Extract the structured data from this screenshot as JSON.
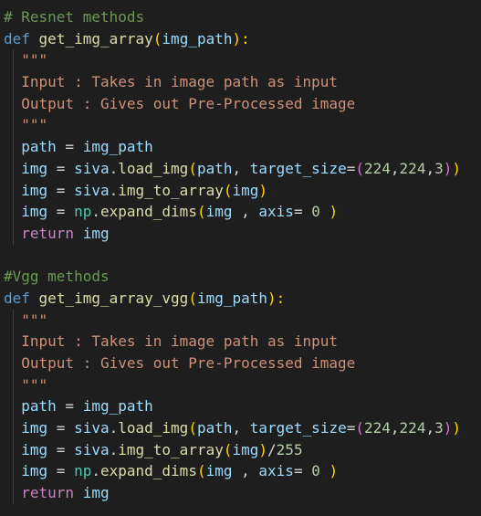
{
  "editor": {
    "lines": [
      {
        "indent": false,
        "tokens": [
          {
            "t": "# Resnet methods",
            "c": "comment"
          }
        ]
      },
      {
        "indent": false,
        "tokens": [
          {
            "t": "def",
            "c": "kw"
          },
          {
            "t": " ",
            "c": "plain"
          },
          {
            "t": "get_img_array",
            "c": "fn"
          },
          {
            "t": "(",
            "c": "b1"
          },
          {
            "t": "img_path",
            "c": "param"
          },
          {
            "t": "):",
            "c": "b1"
          }
        ]
      },
      {
        "indent": true,
        "tokens": [
          {
            "t": "  \"\"\"",
            "c": "str"
          }
        ]
      },
      {
        "indent": true,
        "tokens": [
          {
            "t": "  Input : Takes in image path as input",
            "c": "str"
          }
        ]
      },
      {
        "indent": true,
        "tokens": [
          {
            "t": "  Output : Gives out Pre-Processed image",
            "c": "str"
          }
        ]
      },
      {
        "indent": true,
        "tokens": [
          {
            "t": "  \"\"\"",
            "c": "str"
          }
        ]
      },
      {
        "indent": true,
        "tokens": [
          {
            "t": "  ",
            "c": "plain"
          },
          {
            "t": "path",
            "c": "param"
          },
          {
            "t": " = ",
            "c": "plain"
          },
          {
            "t": "img_path",
            "c": "param"
          }
        ]
      },
      {
        "indent": true,
        "tokens": [
          {
            "t": "  ",
            "c": "plain"
          },
          {
            "t": "img",
            "c": "param"
          },
          {
            "t": " = ",
            "c": "plain"
          },
          {
            "t": "siva",
            "c": "param"
          },
          {
            "t": ".",
            "c": "plain"
          },
          {
            "t": "load_img",
            "c": "fn"
          },
          {
            "t": "(",
            "c": "b1"
          },
          {
            "t": "path",
            "c": "param"
          },
          {
            "t": ", ",
            "c": "plain"
          },
          {
            "t": "target_size",
            "c": "param"
          },
          {
            "t": "=",
            "c": "plain"
          },
          {
            "t": "(",
            "c": "b2"
          },
          {
            "t": "224",
            "c": "num"
          },
          {
            "t": ",",
            "c": "plain"
          },
          {
            "t": "224",
            "c": "num"
          },
          {
            "t": ",",
            "c": "plain"
          },
          {
            "t": "3",
            "c": "num"
          },
          {
            "t": ")",
            "c": "b2"
          },
          {
            "t": ")",
            "c": "b1"
          }
        ]
      },
      {
        "indent": true,
        "tokens": [
          {
            "t": "  ",
            "c": "plain"
          },
          {
            "t": "img",
            "c": "param"
          },
          {
            "t": " = ",
            "c": "plain"
          },
          {
            "t": "siva",
            "c": "param"
          },
          {
            "t": ".",
            "c": "plain"
          },
          {
            "t": "img_to_array",
            "c": "fn"
          },
          {
            "t": "(",
            "c": "b1"
          },
          {
            "t": "img",
            "c": "param"
          },
          {
            "t": ")",
            "c": "b1"
          }
        ]
      },
      {
        "indent": true,
        "tokens": [
          {
            "t": "  ",
            "c": "plain"
          },
          {
            "t": "img",
            "c": "param"
          },
          {
            "t": " = ",
            "c": "plain"
          },
          {
            "t": "np",
            "c": "mod"
          },
          {
            "t": ".",
            "c": "plain"
          },
          {
            "t": "expand_dims",
            "c": "fn"
          },
          {
            "t": "(",
            "c": "b1"
          },
          {
            "t": "img",
            "c": "param"
          },
          {
            "t": " , ",
            "c": "plain"
          },
          {
            "t": "axis",
            "c": "param"
          },
          {
            "t": "= ",
            "c": "plain"
          },
          {
            "t": "0",
            "c": "num"
          },
          {
            "t": " ",
            "c": "plain"
          },
          {
            "t": ")",
            "c": "b1"
          }
        ]
      },
      {
        "indent": true,
        "tokens": [
          {
            "t": "  ",
            "c": "plain"
          },
          {
            "t": "return",
            "c": "ctl"
          },
          {
            "t": " ",
            "c": "plain"
          },
          {
            "t": "img",
            "c": "param"
          }
        ]
      },
      {
        "indent": false,
        "tokens": [
          {
            "t": "",
            "c": "plain"
          }
        ]
      },
      {
        "indent": false,
        "tokens": [
          {
            "t": "#Vgg methods",
            "c": "comment"
          }
        ]
      },
      {
        "indent": false,
        "tokens": [
          {
            "t": "def",
            "c": "kw"
          },
          {
            "t": " ",
            "c": "plain"
          },
          {
            "t": "get_img_array_vgg",
            "c": "fn"
          },
          {
            "t": "(",
            "c": "b1"
          },
          {
            "t": "img_path",
            "c": "param"
          },
          {
            "t": "):",
            "c": "b1"
          }
        ]
      },
      {
        "indent": true,
        "tokens": [
          {
            "t": "  \"\"\"",
            "c": "str"
          }
        ]
      },
      {
        "indent": true,
        "tokens": [
          {
            "t": "  Input : Takes in image path as input",
            "c": "str"
          }
        ]
      },
      {
        "indent": true,
        "tokens": [
          {
            "t": "  Output : Gives out Pre-Processed image",
            "c": "str"
          }
        ]
      },
      {
        "indent": true,
        "tokens": [
          {
            "t": "  \"\"\"",
            "c": "str"
          }
        ]
      },
      {
        "indent": true,
        "tokens": [
          {
            "t": "  ",
            "c": "plain"
          },
          {
            "t": "path",
            "c": "param"
          },
          {
            "t": " = ",
            "c": "plain"
          },
          {
            "t": "img_path",
            "c": "param"
          }
        ]
      },
      {
        "indent": true,
        "tokens": [
          {
            "t": "  ",
            "c": "plain"
          },
          {
            "t": "img",
            "c": "param"
          },
          {
            "t": " = ",
            "c": "plain"
          },
          {
            "t": "siva",
            "c": "param"
          },
          {
            "t": ".",
            "c": "plain"
          },
          {
            "t": "load_img",
            "c": "fn"
          },
          {
            "t": "(",
            "c": "b1"
          },
          {
            "t": "path",
            "c": "param"
          },
          {
            "t": ", ",
            "c": "plain"
          },
          {
            "t": "target_size",
            "c": "param"
          },
          {
            "t": "=",
            "c": "plain"
          },
          {
            "t": "(",
            "c": "b2"
          },
          {
            "t": "224",
            "c": "num"
          },
          {
            "t": ",",
            "c": "plain"
          },
          {
            "t": "224",
            "c": "num"
          },
          {
            "t": ",",
            "c": "plain"
          },
          {
            "t": "3",
            "c": "num"
          },
          {
            "t": ")",
            "c": "b2"
          },
          {
            "t": ")",
            "c": "b1"
          }
        ]
      },
      {
        "indent": true,
        "tokens": [
          {
            "t": "  ",
            "c": "plain"
          },
          {
            "t": "img",
            "c": "param"
          },
          {
            "t": " = ",
            "c": "plain"
          },
          {
            "t": "siva",
            "c": "param"
          },
          {
            "t": ".",
            "c": "plain"
          },
          {
            "t": "img_to_array",
            "c": "fn"
          },
          {
            "t": "(",
            "c": "b1"
          },
          {
            "t": "img",
            "c": "param"
          },
          {
            "t": ")",
            "c": "b1"
          },
          {
            "t": "/",
            "c": "plain"
          },
          {
            "t": "255",
            "c": "num"
          }
        ]
      },
      {
        "indent": true,
        "tokens": [
          {
            "t": "  ",
            "c": "plain"
          },
          {
            "t": "img",
            "c": "param"
          },
          {
            "t": " = ",
            "c": "plain"
          },
          {
            "t": "np",
            "c": "mod"
          },
          {
            "t": ".",
            "c": "plain"
          },
          {
            "t": "expand_dims",
            "c": "fn"
          },
          {
            "t": "(",
            "c": "b1"
          },
          {
            "t": "img",
            "c": "param"
          },
          {
            "t": " , ",
            "c": "plain"
          },
          {
            "t": "axis",
            "c": "param"
          },
          {
            "t": "= ",
            "c": "plain"
          },
          {
            "t": "0",
            "c": "num"
          },
          {
            "t": " ",
            "c": "plain"
          },
          {
            "t": ")",
            "c": "b1"
          }
        ]
      },
      {
        "indent": true,
        "tokens": [
          {
            "t": "  ",
            "c": "plain"
          },
          {
            "t": "return",
            "c": "ctl"
          },
          {
            "t": " ",
            "c": "plain"
          },
          {
            "t": "img",
            "c": "param"
          }
        ]
      }
    ]
  }
}
